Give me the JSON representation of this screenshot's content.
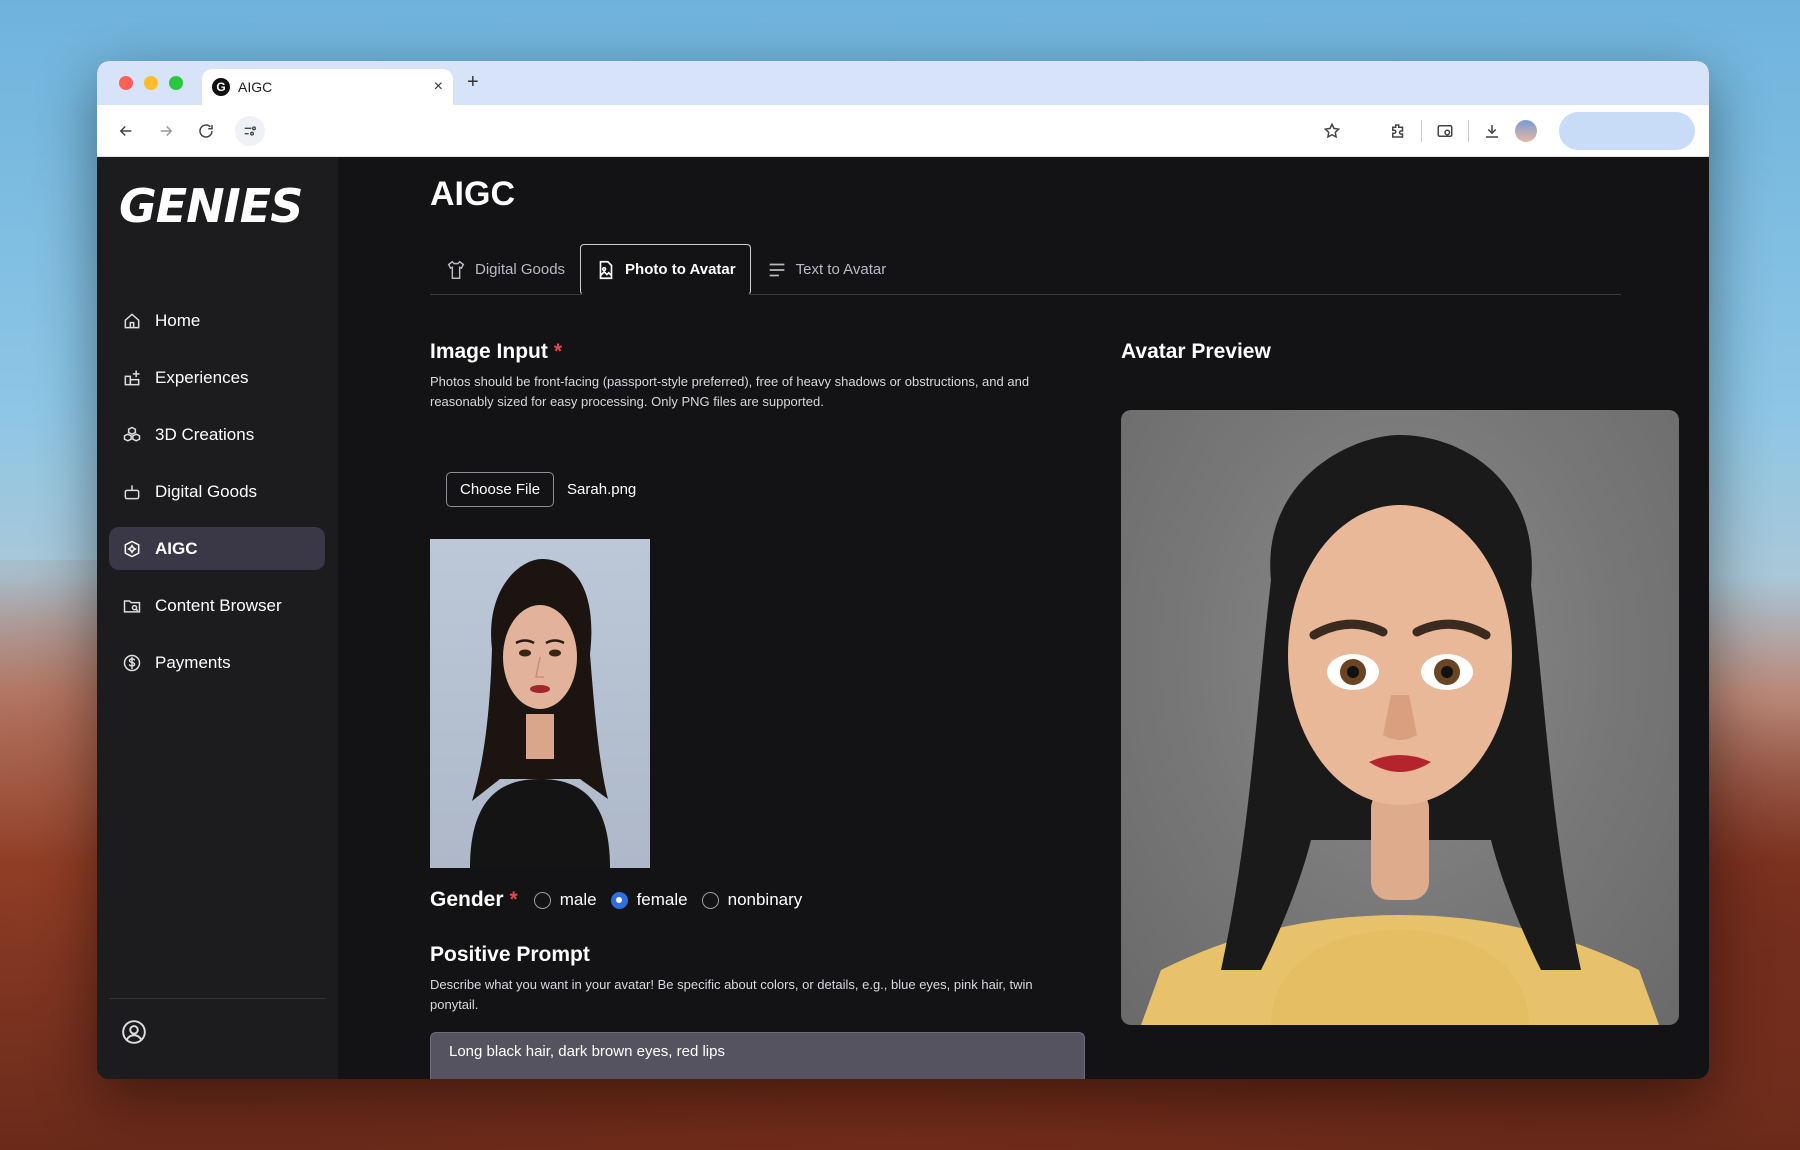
{
  "browser": {
    "tab_title": "AIGC",
    "tab_favicon": "G",
    "close_glyph": "×",
    "new_tab_glyph": "+"
  },
  "sidebar": {
    "logo": "GENIES",
    "items": [
      {
        "label": "Home",
        "icon": "home-icon"
      },
      {
        "label": "Experiences",
        "icon": "grid-plus-icon"
      },
      {
        "label": "3D Creations",
        "icon": "cubes-icon"
      },
      {
        "label": "Digital Goods",
        "icon": "robot-icon"
      },
      {
        "label": "AIGC",
        "icon": "sparkle-cube-icon",
        "active": true
      },
      {
        "label": "Content Browser",
        "icon": "folder-search-icon"
      },
      {
        "label": "Payments",
        "icon": "dollar-circle-icon"
      }
    ]
  },
  "main": {
    "title": "AIGC",
    "tabs": [
      {
        "label": "Digital Goods",
        "icon": "shirt-icon"
      },
      {
        "label": "Photo to Avatar",
        "icon": "photo-icon",
        "active": true
      },
      {
        "label": "Text to Avatar",
        "icon": "text-lines-icon"
      }
    ],
    "image_input": {
      "heading": "Image Input",
      "required": "*",
      "description": "Photos should be front-facing (passport-style preferred), free of heavy shadows or obstructions, and and reasonably sized for easy processing. Only PNG files are supported.",
      "choose_label": "Choose File",
      "file_name": "Sarah.png"
    },
    "gender": {
      "label": "Gender",
      "required": "*",
      "options": [
        "male",
        "female",
        "nonbinary"
      ],
      "selected": "female"
    },
    "positive_prompt": {
      "heading": "Positive Prompt",
      "description": "Describe what you want in your avatar! Be specific about colors, or details, e.g., blue eyes, pink hair, twin ponytail.",
      "value": "Long black hair, dark brown eyes, red lips"
    },
    "preview": {
      "heading": "Avatar Preview"
    }
  },
  "colors": {
    "accent": "#2f6fe0",
    "required": "#e5484d",
    "sidebar_active": "#3a3847"
  }
}
